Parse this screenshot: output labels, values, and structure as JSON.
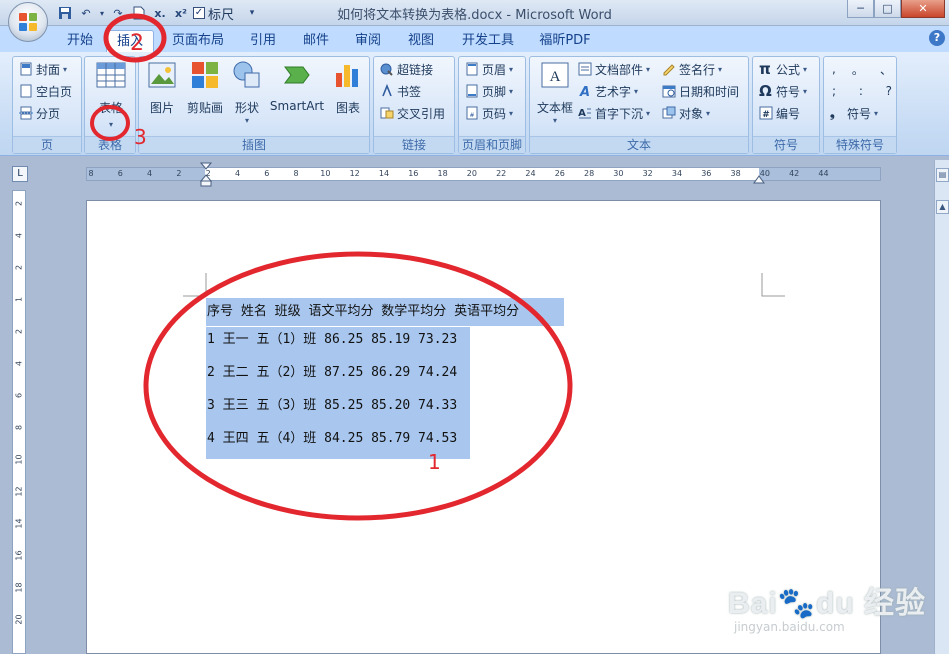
{
  "window": {
    "title": "如何将文本转换为表格.docx - Microsoft Word",
    "controls": [
      "─",
      "□",
      "✕"
    ]
  },
  "quick_access": {
    "ruler_label": "标尺",
    "ruler_checked": "✓",
    "buttons": [
      "save-icon",
      "undo-icon",
      "redo-icon",
      "strikethrough-icon",
      "subscript-icon",
      "superscript-icon"
    ]
  },
  "tabs": [
    {
      "label": "开始"
    },
    {
      "label": "插入",
      "active": true
    },
    {
      "label": "页面布局"
    },
    {
      "label": "引用"
    },
    {
      "label": "邮件"
    },
    {
      "label": "审阅"
    },
    {
      "label": "视图"
    },
    {
      "label": "开发工具"
    },
    {
      "label": "福昕PDF"
    }
  ],
  "ribbon": {
    "pages": {
      "label": "页",
      "items": [
        "封面",
        "空白页",
        "分页"
      ]
    },
    "table": {
      "label": "表格",
      "button": "表格"
    },
    "illustrations": {
      "label": "插图",
      "items": [
        "图片",
        "剪贴画",
        "形状",
        "SmartArt",
        "图表"
      ]
    },
    "links": {
      "label": "链接",
      "items": [
        "超链接",
        "书签",
        "交叉引用"
      ]
    },
    "header_footer": {
      "label": "页眉和页脚",
      "items": [
        "页眉",
        "页脚",
        "页码"
      ]
    },
    "text": {
      "label": "文本",
      "textbox": "文本框",
      "items": [
        "文档部件",
        "艺术字",
        "首字下沉",
        "签名行",
        "日期和时间",
        "对象"
      ]
    },
    "symbols": {
      "label": "符号",
      "items": [
        "公式",
        "符号",
        "编号"
      ]
    },
    "special": {
      "label": "特殊符号",
      "chars": [
        ",",
        "。",
        "、",
        ";",
        ":",
        "?"
      ],
      "more": "符号"
    }
  },
  "ruler": {
    "corner": "L",
    "ticks": [
      "8",
      "6",
      "4",
      "2",
      "2",
      "4",
      "6",
      "8",
      "10",
      "12",
      "14",
      "16",
      "18",
      "20",
      "22",
      "24",
      "26",
      "28",
      "30",
      "32",
      "34",
      "36",
      "38",
      "40",
      "42",
      "44"
    ],
    "vticks": [
      "2",
      "4",
      "2",
      "1",
      "2",
      "4",
      "6",
      "8",
      "10",
      "12",
      "14",
      "16",
      "18",
      "20"
    ]
  },
  "document": {
    "lines": [
      "序号 姓名 班级 语文平均分 数学平均分 英语平均分",
      "1 王一 五（1）班 86.25 85.19 73.23",
      "2 王二 五（2）班 87.25 86.29 74.24",
      "3 王三 五（3）班 85.25 85.20 74.33",
      "4 王四 五（4）班 84.25 85.79 74.53"
    ]
  },
  "annotations": [
    "1",
    "2",
    "3"
  ],
  "colors": {
    "annotation": "#e3272e",
    "selection": "#a9c7ee",
    "ribbon": "#c6dbf4"
  }
}
